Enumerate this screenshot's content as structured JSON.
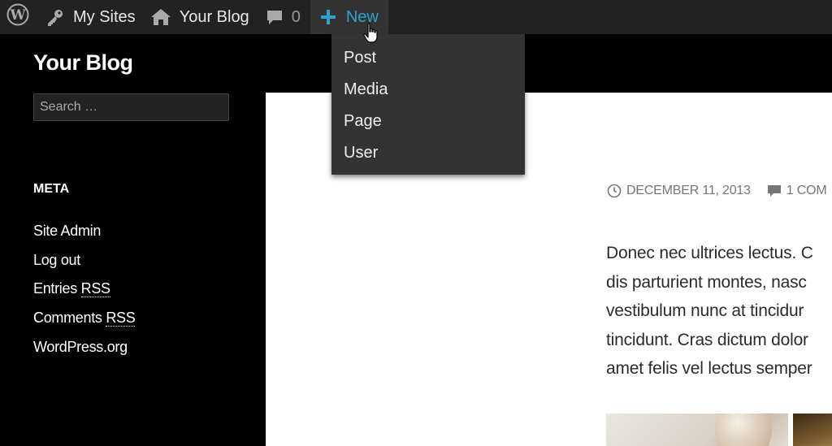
{
  "adminbar": {
    "my_sites": "My Sites",
    "your_blog": "Your Blog",
    "comments_count": "0",
    "new_label": "New"
  },
  "new_menu": {
    "items": [
      "Post",
      "Media",
      "Page",
      "User"
    ]
  },
  "sidebar": {
    "site_title": "Your Blog",
    "search_placeholder": "Search …",
    "meta_heading": "META",
    "meta_links": {
      "site_admin": "Site Admin",
      "log_out": "Log out",
      "entries": "Entries",
      "comments": "Comments",
      "rss": "RSS",
      "wordpress": "WordPress.org"
    }
  },
  "post": {
    "date": "DECEMBER 11, 2013",
    "comments": "1 COM",
    "lines": [
      "Donec nec ultrices lectus. C",
      "dis parturient montes, nasc",
      "vestibulum nunc at tincidur",
      "tincidunt. Cras dictum dolor",
      "amet felis vel lectus semper"
    ]
  },
  "colors": {
    "adminbar_bg": "#222222",
    "accent": "#2ea2cc",
    "page_bg": "#000000",
    "content_bg": "#ffffff"
  }
}
